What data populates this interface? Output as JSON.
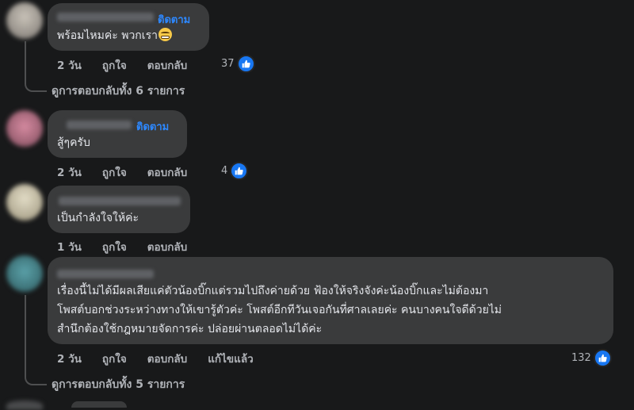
{
  "comments": [
    {
      "follow_label": "ติดตาม",
      "text": "พร้อมไหมค่ะ พวกเรา",
      "emoji": "grimacing-emoji",
      "time": "2 วัน",
      "like_label": "ถูกใจ",
      "reply_label": "ตอบกลับ",
      "reaction_count": "37",
      "view_replies": "ดูการตอบกลับทั้ง 6 รายการ"
    },
    {
      "follow_label": "ติดตาม",
      "text": "สู้ๆครับ",
      "time": "2 วัน",
      "like_label": "ถูกใจ",
      "reply_label": "ตอบกลับ",
      "reaction_count": "4"
    },
    {
      "text": "เป็นกำลังใจให้ค่ะ",
      "time": "1 วัน",
      "like_label": "ถูกใจ",
      "reply_label": "ตอบกลับ"
    },
    {
      "text_lines": [
        "เรื่องนี้ไม่ได้มีผลเสียแค่ตัวน้องบิ๊กแต่รวมไปถึงค่ายด้วย ฟ้องให้จริงจังค่ะน้องบิ๊กและไม่ต้องมา",
        "โพสต์บอกช่วงระหว่างทางให้เขารู้ตัวค่ะ โพสต์อีกทีวันเจอกันที่ศาลเลยค่ะ คนบางคนใจดีด้วยไม่",
        "สำนึกต้องใช้กฎหมายจัดการค่ะ ปล่อยผ่านตลอดไม่ได้ค่ะ"
      ],
      "time": "2 วัน",
      "like_label": "ถูกใจ",
      "reply_label": "ตอบกลับ",
      "edited_label": "แก้ไขแล้ว",
      "reaction_count": "132",
      "view_replies": "ดูการตอบกลับทั้ง 5 รายการ"
    }
  ],
  "colors": {
    "background": "#18191a",
    "bubble": "#3a3b3c",
    "accent": "#2d88ff",
    "like_blue": "#1877f2"
  }
}
